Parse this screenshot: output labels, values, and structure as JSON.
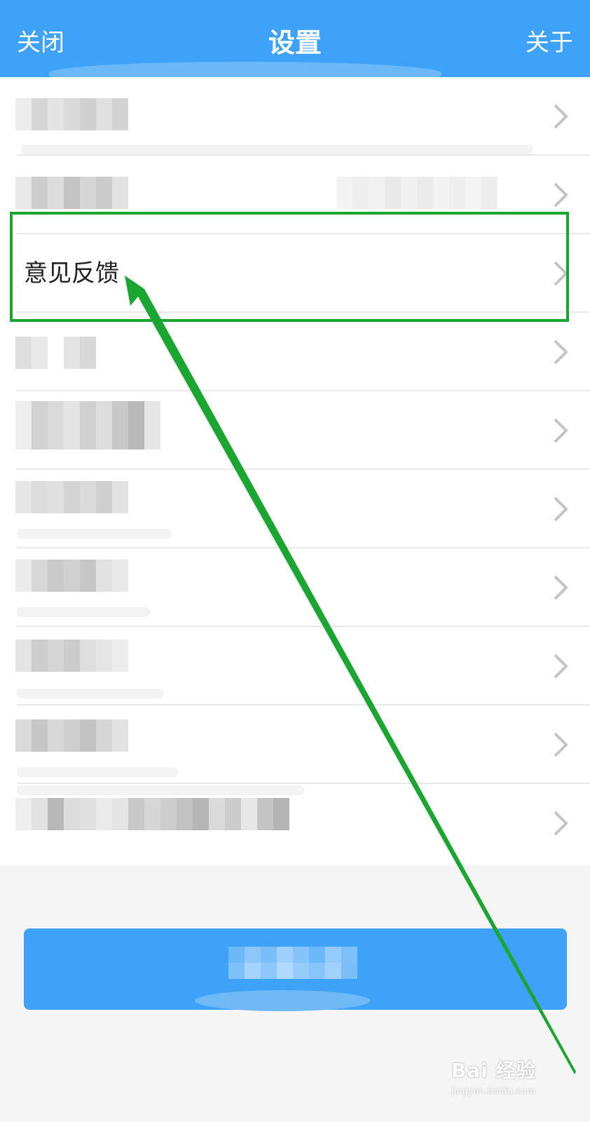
{
  "header": {
    "left_label": "关闭",
    "title": "设置",
    "right_label": "关于",
    "bg_color": "#3ea2f8"
  },
  "list": {
    "feedback_label": "意见反馈",
    "chevron_icon": "chevron-right-icon",
    "rows_total": 10
  },
  "annotation": {
    "highlight_color": "#1aa630"
  },
  "watermark": {
    "main": "Bai 经验",
    "sub": "jingyan.baidu.com"
  },
  "colors": {
    "accent": "#3ea2f8",
    "divider": "#e7e7e7",
    "chevron": "#c4c4c4",
    "page_bg": "#f5f5f5"
  }
}
